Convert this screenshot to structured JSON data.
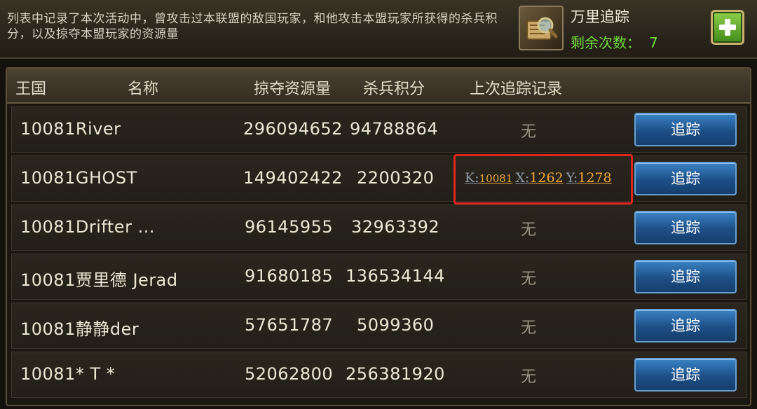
{
  "header": {
    "description": "列表中记录了本次活动中，曾攻击过本联盟的敌国玩家，和他攻击本盟玩家所获得的杀兵积分，以及掠夺本盟玩家的资源量",
    "item_name": "万里追踪",
    "remaining_label": "剩余次数：",
    "remaining_count": "7",
    "item_icon": "map-magnifier-icon",
    "add_icon": "plus-icon"
  },
  "table": {
    "columns": {
      "kingdom": "王国",
      "name": "名称",
      "resources": "掠夺资源量",
      "kills": "杀兵积分",
      "last_track": "上次追踪记录"
    },
    "rows": [
      {
        "player": "10081River",
        "resources": "296094652",
        "kills": "94788864",
        "last_track": "无",
        "action": "追踪"
      },
      {
        "player": "10081GHOST",
        "resources": "149402422",
        "kills": "2200320",
        "last_track": "",
        "action": "追踪"
      },
      {
        "player": "10081Drifter ...",
        "resources": "96145955",
        "kills": "32963392",
        "last_track": "无",
        "action": "追踪"
      },
      {
        "player": "10081贾里德 Jerad",
        "resources": "91680185",
        "kills": "136534144",
        "last_track": "无",
        "action": "追踪"
      },
      {
        "player": "10081静静der",
        "resources": "57651787",
        "kills": "5099360",
        "last_track": "无",
        "action": "追踪"
      },
      {
        "player": "10081* T *",
        "resources": "52062800",
        "kills": "256381920",
        "last_track": "无",
        "action": "追踪"
      }
    ]
  },
  "coords": {
    "k_label": "K:",
    "k_value": "10081",
    "x_label": "X:",
    "x_value": "1262",
    "y_label": "Y:",
    "y_value": "1278"
  },
  "colors": {
    "remaining": "#6fdc3a",
    "coord_value": "#f0a838",
    "highlight_box": "#e0251e",
    "track_button": "#1d4f86"
  }
}
